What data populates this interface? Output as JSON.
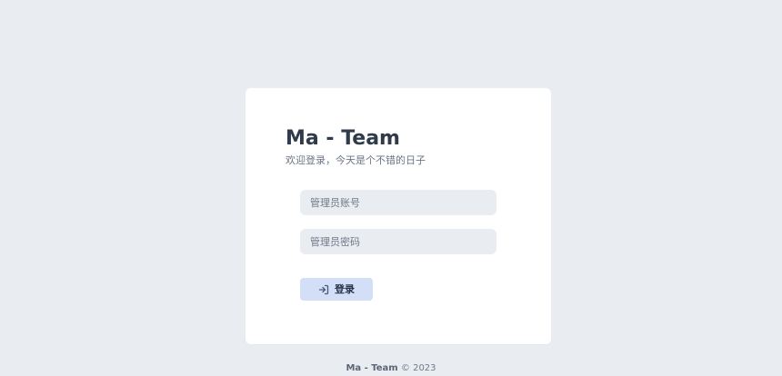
{
  "login_card": {
    "title": "Ma - Team",
    "subtitle": "欢迎登录，今天是个不错的日子",
    "account_placeholder": "管理员账号",
    "password_placeholder": "管理员密码",
    "login_button_label": "登录",
    "login_icon": "sign-in-icon"
  },
  "footer": {
    "brand": "Ma - Team",
    "copyright": "© 2023"
  },
  "colors": {
    "background": "#e9edf2",
    "card": "#ffffff",
    "button": "#d3def7",
    "title_text": "#2f3b4a"
  }
}
